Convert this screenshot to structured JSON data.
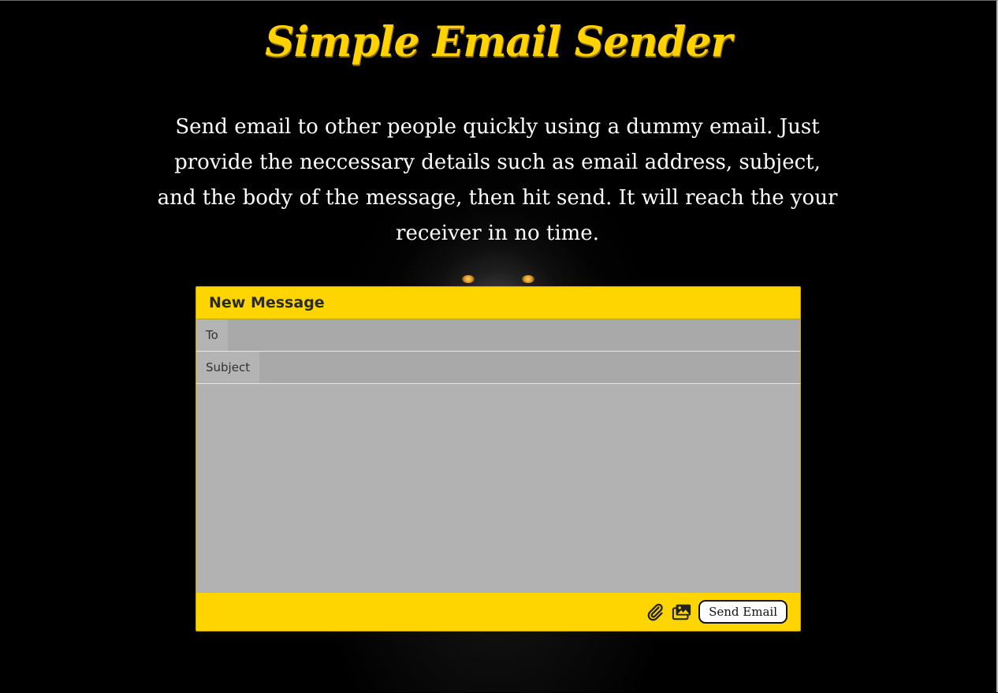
{
  "header": {
    "title": "Simple Email Sender",
    "intro": "Send email to other people quickly using a dummy email. Just provide the neccessary details such as email address, subject, and the body of the message, then hit send. It will reach the your receiver in no time."
  },
  "form": {
    "heading": "New Message",
    "to_label": "To",
    "to_value": "",
    "subject_label": "Subject",
    "subject_value": "",
    "body_value": "",
    "send_label": "Send Email"
  },
  "icons": {
    "attach": "paperclip-icon",
    "images": "images-icon"
  },
  "colors": {
    "accent": "#ffd500",
    "title": "#ffd200",
    "background": "#000000"
  }
}
